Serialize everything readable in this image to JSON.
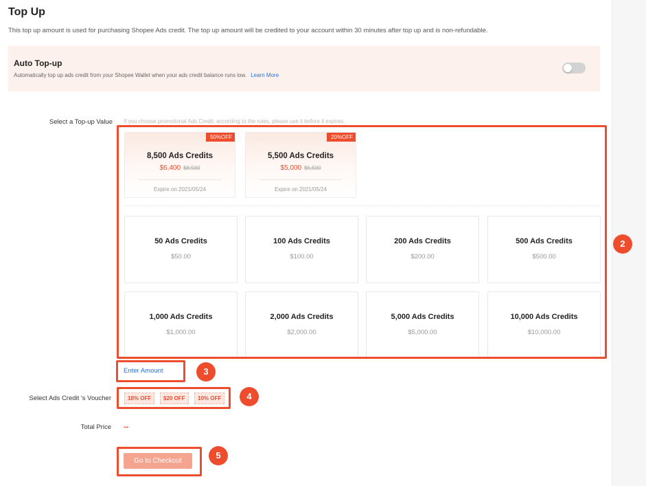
{
  "page": {
    "title": "Top Up",
    "description": "This top up amount is used for purchasing Shopee Ads credit. The top up amount will be credited to your account within 30 minutes after top up and is non-refundable."
  },
  "auto_topup": {
    "title": "Auto Top-up",
    "description": "Automatically top up ads credit from your Shopee Wallet when your ads credit balance runs low.",
    "learn_more": "Learn More",
    "enabled": false
  },
  "topup": {
    "label": "Select a Top-up Value",
    "hint": "If you choose promotional Ads Credit, according to the rules, please use it before it expires.",
    "promo_options": [
      {
        "badge": "50%OFF",
        "name": "8,500 Ads Credits",
        "price": "$6,400",
        "original_price": "$8,500",
        "expiry": "Expire on 2021/05/24"
      },
      {
        "badge": "20%OFF",
        "name": "5,500 Ads Credits",
        "price": "$5,000",
        "original_price": "$5,500",
        "expiry": "Expire on 2021/05/24"
      }
    ],
    "options": [
      {
        "name": "50 Ads Credits",
        "price": "$50.00"
      },
      {
        "name": "100 Ads Credits",
        "price": "$100.00"
      },
      {
        "name": "200 Ads Credits",
        "price": "$200.00"
      },
      {
        "name": "500 Ads Credits",
        "price": "$500.00"
      },
      {
        "name": "1,000 Ads Credits",
        "price": "$1,000.00"
      },
      {
        "name": "2,000 Ads Credits",
        "price": "$2,000.00"
      },
      {
        "name": "5,000 Ads Credits",
        "price": "$5,000.00"
      },
      {
        "name": "10,000 Ads Credits",
        "price": "$10,000.00"
      }
    ],
    "enter_amount": "Enter Amount"
  },
  "voucher": {
    "label": "Select Ads Credit 's Voucher",
    "items": [
      "18% OFF",
      "$20 OFF",
      "10% OFF"
    ]
  },
  "total": {
    "label": "Total Price",
    "value": "--"
  },
  "checkout": {
    "label": "Go to Checkout"
  },
  "markers": [
    "2",
    "3",
    "4",
    "5"
  ],
  "colors": {
    "accent": "#ee4d2d",
    "link": "#2673dd",
    "panel_bg": "#fdf1ed",
    "checkout_disabled": "#f5a48f"
  }
}
